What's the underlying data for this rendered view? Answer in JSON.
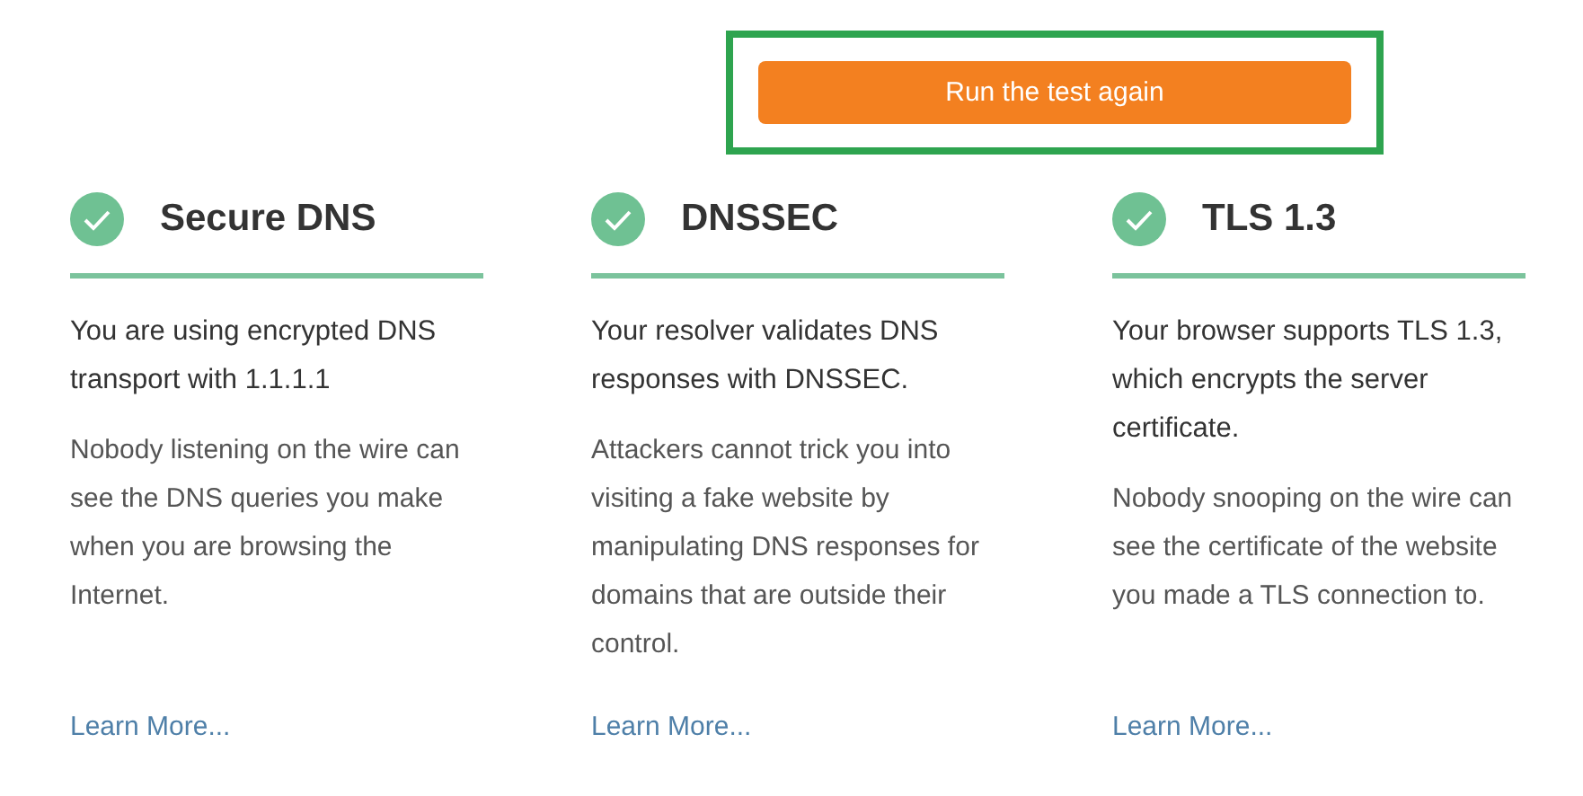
{
  "action": {
    "label": "Run the test again",
    "highlighted": true
  },
  "checks": [
    {
      "title": "Secure DNS",
      "passed": true,
      "summary": "You are using encrypted DNS transport with 1.1.1.1",
      "detail": "Nobody listening on the wire can see the DNS queries you make when you are browsing the Internet.",
      "link": "Learn More..."
    },
    {
      "title": "DNSSEC",
      "passed": true,
      "summary": "Your resolver validates DNS responses with DNSSEC.",
      "detail": "Attackers cannot trick you into visiting a fake website by manipulating DNS responses for domains that are outside their control.",
      "link": "Learn More..."
    },
    {
      "title": "TLS 1.3",
      "passed": true,
      "summary": "Your browser supports TLS 1.3, which encrypts the server certificate.",
      "detail": "Nobody snooping on the wire can see the certificate of the website you made a TLS connection to.",
      "link": "Learn More..."
    }
  ]
}
